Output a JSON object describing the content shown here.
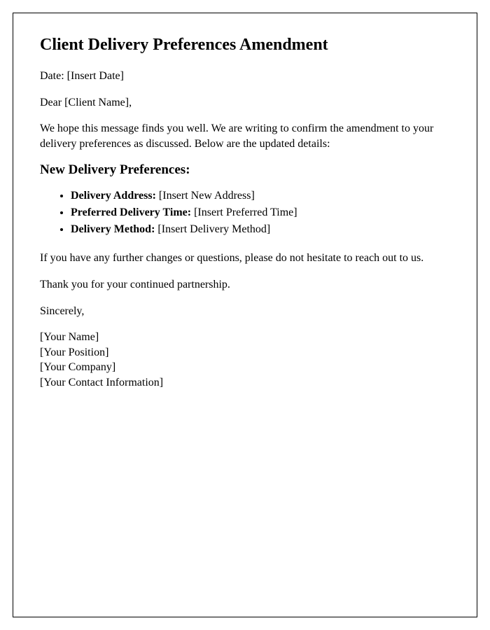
{
  "document": {
    "title": "Client Delivery Preferences Amendment",
    "date_label": "Date: ",
    "date_value": "[Insert Date]",
    "salutation_prefix": "Dear ",
    "salutation_name": "[Client Name]",
    "salutation_suffix": ",",
    "intro_paragraph": "We hope this message finds you well. We are writing to confirm the amendment to your delivery preferences as discussed. Below are the updated details:",
    "section_heading": "New Delivery Preferences:",
    "preferences": [
      {
        "label": "Delivery Address:",
        "value": " [Insert New Address]"
      },
      {
        "label": "Preferred Delivery Time:",
        "value": " [Insert Preferred Time]"
      },
      {
        "label": "Delivery Method:",
        "value": " [Insert Delivery Method]"
      }
    ],
    "followup_paragraph": "If you have any further changes or questions, please do not hesitate to reach out to us.",
    "thanks_paragraph": "Thank you for your continued partnership.",
    "closing": "Sincerely,",
    "signature": {
      "name": "[Your Name]",
      "position": "[Your Position]",
      "company": "[Your Company]",
      "contact": "[Your Contact Information]"
    }
  }
}
